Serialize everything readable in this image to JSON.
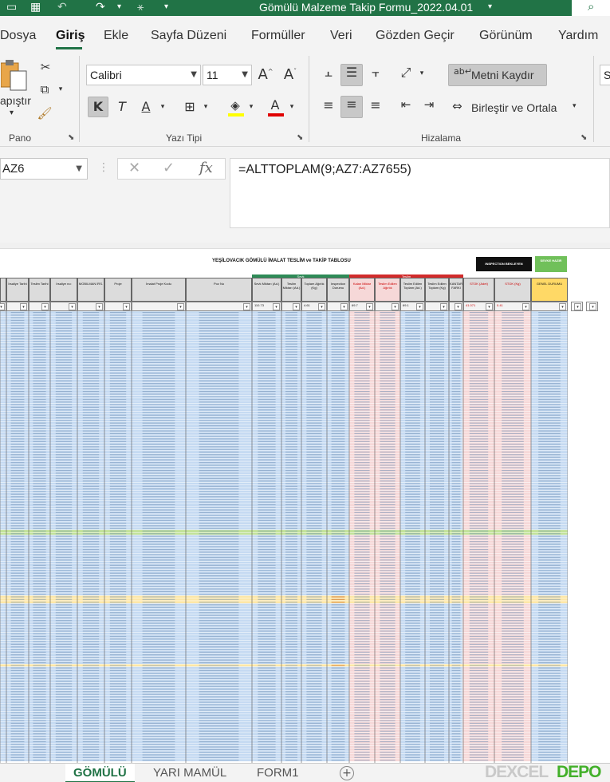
{
  "window": {
    "title": "Gömülü Malzeme Takip Formu_2022.04.01"
  },
  "colors": {
    "brand": "#217346",
    "row_blue": "#c5daf2",
    "row_green": "#c2e29a",
    "row_yellow": "#fde7a7",
    "pink": "#f6d8d8",
    "group_green": "#2e8b57",
    "group_red": "#d22b2b",
    "sevk_yellow": "#ffd966"
  },
  "ribbon_tabs": [
    "Dosya",
    "Giriş",
    "Ekle",
    "Sayfa Düzeni",
    "Formüller",
    "Veri",
    "Gözden Geçir",
    "Görünüm",
    "Yardım"
  ],
  "ribbon": {
    "pano": {
      "paste_label": "apıştır",
      "group_label": "Pano"
    },
    "font": {
      "name": "Calibri",
      "size": "11",
      "group_label": "Yazı Tipi",
      "bold": "K",
      "italic": "T",
      "underline": "A",
      "font_color": "A"
    },
    "alignment": {
      "wrap_text": "Metni Kaydır",
      "merge_center": "Birleştir ve Ortala",
      "group_label": "Hizalama"
    },
    "number": {
      "partial": "S"
    }
  },
  "formula_bar": {
    "name_box": "AZ6",
    "formula": "=ALTTOPLAM(9;AZ7:AZ7655)",
    "fx": "fx"
  },
  "sheet": {
    "title": "YEŞİLOVACIK GÖMÜLÜ İMALAT TESLİM ve TAKİP TABLOSU",
    "inspection_box": "INSPECTION BEKLEYEN",
    "sevk_box": "SEVKE HAZIR",
    "group_sevk": "Sevk",
    "group_teslim": "Teslim",
    "headers": [
      "İrsaliye Tarihi",
      "Teslim Tarihi",
      "İrsaliye no:",
      "MOBILMAN İRS.",
      "Proje",
      "İmalat Proje Kodu",
      "Poz No",
      "Sevk Miktarı (Ad.)",
      "Teslim Miktarı (Ad.)",
      "Toplam Ağırlık (Kg)",
      "Inspection Durumu",
      "Kalan Miktar (Ad.)",
      "Teslim Edilen Ağırlık",
      "Teslim Edilen Toplam (Ad.)",
      "Teslim Edilen Toplam (Kg)",
      "KANTAR FARKI",
      "STOK (Adet)",
      "STOK (Kg)",
      "GENEL DURUMU"
    ],
    "totals": {
      "sevk": "110.73",
      "toplam_kg": "4.61",
      "kalan": "69.7",
      "teslim_ad": "69.1",
      "stok_ad": "41.071",
      "stok_kg": "0.41"
    }
  },
  "sheet_tabs": [
    "GÖMÜLÜ",
    "YARI MAMÜL",
    "FORM1"
  ],
  "watermark": {
    "part1": "DEXCEL",
    "part2": "DEPO"
  }
}
